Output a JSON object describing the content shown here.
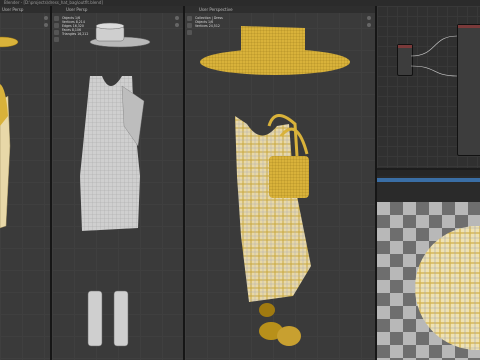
{
  "window": {
    "title": "Blender - [D:\\projects\\dress_hat_bag\\outfit.blend]"
  },
  "viewports": {
    "left": {
      "label": "User Persp"
    },
    "middle": {
      "label": "User Persp",
      "stats": "Objects 1/6\nVertices 8,214\nEdges 16,320\nFaces 8,106\nTriangles 16,212"
    },
    "right": {
      "label": "User Perspective",
      "stats": "Collection | Dress\nObjects 1/6\nVertices 24,512"
    }
  },
  "colors": {
    "fabric_yellow": "#d9b23a",
    "fabric_light": "#e8d8a8",
    "mesh_grey": "#cfcfcf",
    "selection_blue": "#3a6ea5",
    "node_header": "#7a3a3a"
  },
  "icons": [
    "move-icon",
    "rotate-icon",
    "scale-icon",
    "cursor-icon",
    "zoom-icon",
    "pan-icon"
  ]
}
